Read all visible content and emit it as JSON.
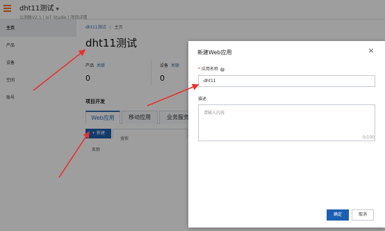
{
  "header": {
    "app_title": "dht11测试",
    "caret": "▼",
    "subtitle": "公测版V2.1 | IoT Studio | 项目详情"
  },
  "sidebar": {
    "items": [
      {
        "label": "主页",
        "active": true
      },
      {
        "label": "产品",
        "active": false
      },
      {
        "label": "设备",
        "active": false
      },
      {
        "label": "空间",
        "active": false
      },
      {
        "label": "账号",
        "active": false
      }
    ]
  },
  "main": {
    "breadcrumb": {
      "parent": "dht11测试",
      "sep": "/",
      "current": "主页"
    },
    "title": "dht11测试",
    "stats": [
      {
        "label": "产品",
        "link": "关联",
        "value": "0"
      },
      {
        "label": "设备",
        "link": "关联",
        "value": "0"
      }
    ],
    "section_title": "项目开发",
    "tabs": [
      {
        "label": "Web应用",
        "active": true
      },
      {
        "label": "移动应用",
        "active": false
      },
      {
        "label": "业务服务",
        "active": false
      }
    ],
    "new_button": "+ 新建",
    "search_placeholder": "搜索",
    "column_name": "名称"
  },
  "modal": {
    "title": "新建Web应用",
    "close": "×",
    "name_label": "应用名称",
    "name_required": "*",
    "name_help": "?",
    "name_value": "dht11",
    "desc_label": "描述",
    "desc_placeholder": "请输入内容",
    "counter": "0/100",
    "confirm": "确定",
    "cancel": "取消"
  },
  "colors": {
    "accent": "#2f6eb5",
    "primary_button": "#1d5fb0",
    "brand_orange": "#f37021",
    "annotation_arrow": "#e8322b"
  }
}
